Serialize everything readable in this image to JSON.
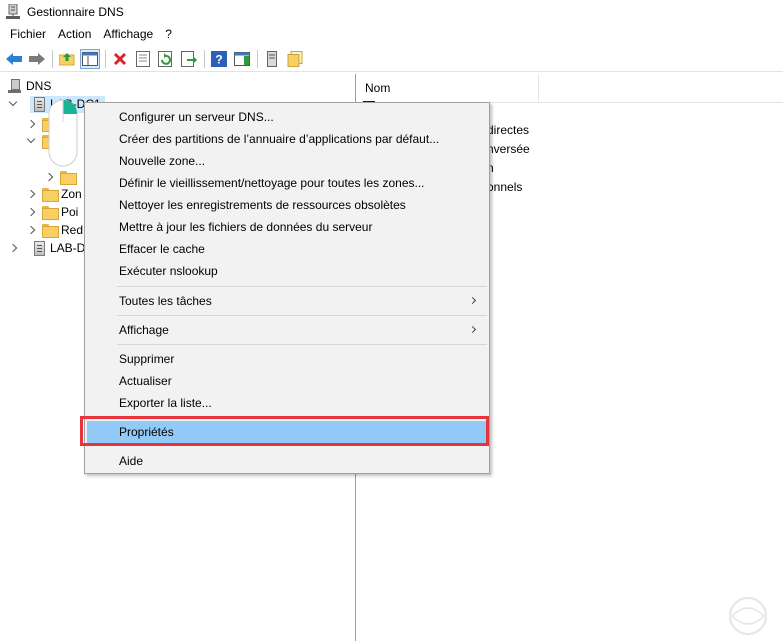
{
  "window": {
    "title": "Gestionnaire DNS"
  },
  "menubar": {
    "items": [
      "Fichier",
      "Action",
      "Affichage",
      "?"
    ]
  },
  "toolbar": {
    "icons": [
      "back-arrow",
      "forward-arrow",
      "up-folder",
      "show-hide-console-tree",
      "delete",
      "properties",
      "refresh",
      "export-list",
      "help",
      "show-action-pane",
      "server",
      "folders"
    ]
  },
  "tree": {
    "root": "DNS",
    "server1": "LAB-DC1",
    "child_partial_1": "c",
    "child_partial_2": "n",
    "zones": "Zon",
    "points": "Poi",
    "redirecteurs": "Red",
    "server2": "LAB-DC"
  },
  "list": {
    "column_name": "Nom",
    "rows_partial": [
      "directes",
      "nversée",
      "n",
      "onnels"
    ]
  },
  "context_menu": {
    "items": [
      "Configurer un serveur DNS...",
      "Créer des partitions de l’annuaire d’applications par défaut...",
      "Nouvelle zone...",
      "Définir le vieillissement/nettoyage pour toutes les zones...",
      "Nettoyer les enregistrements de ressources obsolètes",
      "Mettre à jour les fichiers de données du serveur",
      "Effacer le cache",
      "Exécuter nslookup",
      "Toutes les tâches",
      "Affichage",
      "Supprimer",
      "Actualiser",
      "Exporter la liste...",
      "Propriétés",
      "Aide"
    ],
    "highlighted": "Propriétés"
  },
  "colors": {
    "highlight_border": "#e8343c",
    "hover_bg": "#91c9f7",
    "selection_bg": "#cce8ff"
  }
}
